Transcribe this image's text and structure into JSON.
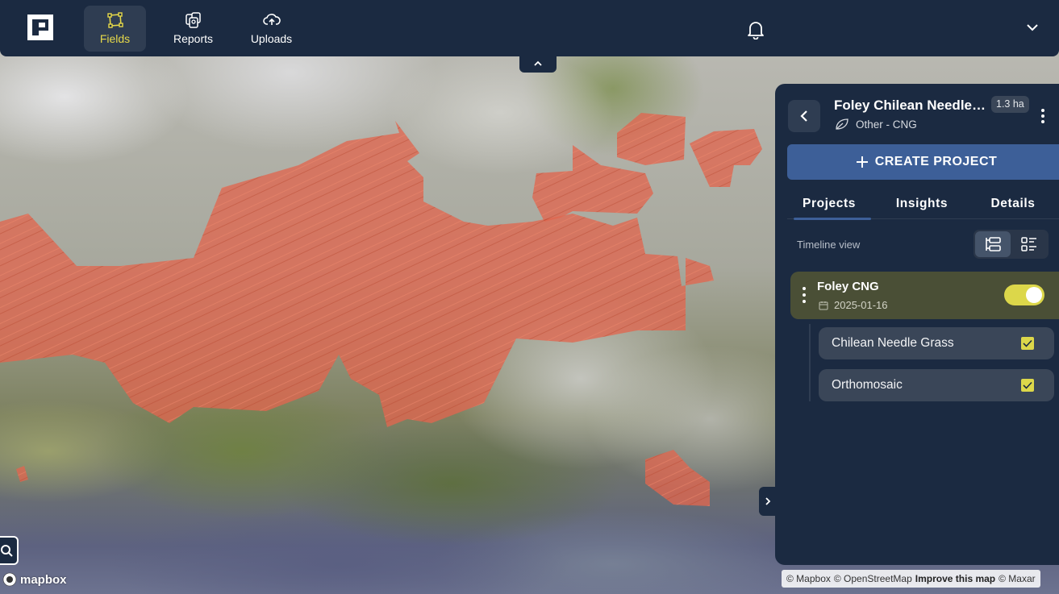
{
  "nav": {
    "tabs": [
      {
        "label": "Fields",
        "icon": "polygon-icon",
        "active": true
      },
      {
        "label": "Reports",
        "icon": "reports-icon",
        "active": false
      },
      {
        "label": "Uploads",
        "icon": "cloud-upload-icon",
        "active": false
      }
    ]
  },
  "field": {
    "title": "Foley Chilean Needle Grass",
    "area": "1.3 ha",
    "subtitle": "Other - CNG"
  },
  "actions": {
    "create_project": "CREATE PROJECT"
  },
  "panel_tabs": [
    {
      "label": "Projects",
      "active": true
    },
    {
      "label": "Insights",
      "active": false
    },
    {
      "label": "Details",
      "active": false
    }
  ],
  "view": {
    "label": "Timeline view",
    "selected": "timeline"
  },
  "project": {
    "name": "Foley CNG",
    "date": "2025-01-16",
    "visible": true,
    "layers": [
      {
        "label": "Chilean Needle Grass",
        "checked": true
      },
      {
        "label": "Orthomosaic",
        "checked": true
      }
    ]
  },
  "map": {
    "brand": "mapbox",
    "attribution": {
      "mapbox": "© Mapbox",
      "osm": "© OpenStreetMap",
      "improve": "Improve this map",
      "maxar": "© Maxar"
    },
    "overlay_color": "#e0674f"
  },
  "colors": {
    "navy": "#1b2a41",
    "accent_yellow": "#dcd74a",
    "button_blue": "#3d5f98"
  }
}
